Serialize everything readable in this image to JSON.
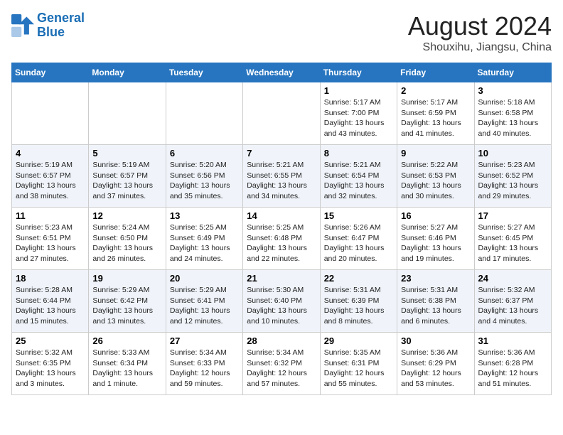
{
  "header": {
    "logo_line1": "General",
    "logo_line2": "Blue",
    "title": "August 2024",
    "subtitle": "Shouxihu, Jiangsu, China"
  },
  "days_of_week": [
    "Sunday",
    "Monday",
    "Tuesday",
    "Wednesday",
    "Thursday",
    "Friday",
    "Saturday"
  ],
  "weeks": [
    [
      {
        "day": "",
        "content": ""
      },
      {
        "day": "",
        "content": ""
      },
      {
        "day": "",
        "content": ""
      },
      {
        "day": "",
        "content": ""
      },
      {
        "day": "1",
        "content": "Sunrise: 5:17 AM\nSunset: 7:00 PM\nDaylight: 13 hours\nand 43 minutes."
      },
      {
        "day": "2",
        "content": "Sunrise: 5:17 AM\nSunset: 6:59 PM\nDaylight: 13 hours\nand 41 minutes."
      },
      {
        "day": "3",
        "content": "Sunrise: 5:18 AM\nSunset: 6:58 PM\nDaylight: 13 hours\nand 40 minutes."
      }
    ],
    [
      {
        "day": "4",
        "content": "Sunrise: 5:19 AM\nSunset: 6:57 PM\nDaylight: 13 hours\nand 38 minutes."
      },
      {
        "day": "5",
        "content": "Sunrise: 5:19 AM\nSunset: 6:57 PM\nDaylight: 13 hours\nand 37 minutes."
      },
      {
        "day": "6",
        "content": "Sunrise: 5:20 AM\nSunset: 6:56 PM\nDaylight: 13 hours\nand 35 minutes."
      },
      {
        "day": "7",
        "content": "Sunrise: 5:21 AM\nSunset: 6:55 PM\nDaylight: 13 hours\nand 34 minutes."
      },
      {
        "day": "8",
        "content": "Sunrise: 5:21 AM\nSunset: 6:54 PM\nDaylight: 13 hours\nand 32 minutes."
      },
      {
        "day": "9",
        "content": "Sunrise: 5:22 AM\nSunset: 6:53 PM\nDaylight: 13 hours\nand 30 minutes."
      },
      {
        "day": "10",
        "content": "Sunrise: 5:23 AM\nSunset: 6:52 PM\nDaylight: 13 hours\nand 29 minutes."
      }
    ],
    [
      {
        "day": "11",
        "content": "Sunrise: 5:23 AM\nSunset: 6:51 PM\nDaylight: 13 hours\nand 27 minutes."
      },
      {
        "day": "12",
        "content": "Sunrise: 5:24 AM\nSunset: 6:50 PM\nDaylight: 13 hours\nand 26 minutes."
      },
      {
        "day": "13",
        "content": "Sunrise: 5:25 AM\nSunset: 6:49 PM\nDaylight: 13 hours\nand 24 minutes."
      },
      {
        "day": "14",
        "content": "Sunrise: 5:25 AM\nSunset: 6:48 PM\nDaylight: 13 hours\nand 22 minutes."
      },
      {
        "day": "15",
        "content": "Sunrise: 5:26 AM\nSunset: 6:47 PM\nDaylight: 13 hours\nand 20 minutes."
      },
      {
        "day": "16",
        "content": "Sunrise: 5:27 AM\nSunset: 6:46 PM\nDaylight: 13 hours\nand 19 minutes."
      },
      {
        "day": "17",
        "content": "Sunrise: 5:27 AM\nSunset: 6:45 PM\nDaylight: 13 hours\nand 17 minutes."
      }
    ],
    [
      {
        "day": "18",
        "content": "Sunrise: 5:28 AM\nSunset: 6:44 PM\nDaylight: 13 hours\nand 15 minutes."
      },
      {
        "day": "19",
        "content": "Sunrise: 5:29 AM\nSunset: 6:42 PM\nDaylight: 13 hours\nand 13 minutes."
      },
      {
        "day": "20",
        "content": "Sunrise: 5:29 AM\nSunset: 6:41 PM\nDaylight: 13 hours\nand 12 minutes."
      },
      {
        "day": "21",
        "content": "Sunrise: 5:30 AM\nSunset: 6:40 PM\nDaylight: 13 hours\nand 10 minutes."
      },
      {
        "day": "22",
        "content": "Sunrise: 5:31 AM\nSunset: 6:39 PM\nDaylight: 13 hours\nand 8 minutes."
      },
      {
        "day": "23",
        "content": "Sunrise: 5:31 AM\nSunset: 6:38 PM\nDaylight: 13 hours\nand 6 minutes."
      },
      {
        "day": "24",
        "content": "Sunrise: 5:32 AM\nSunset: 6:37 PM\nDaylight: 13 hours\nand 4 minutes."
      }
    ],
    [
      {
        "day": "25",
        "content": "Sunrise: 5:32 AM\nSunset: 6:35 PM\nDaylight: 13 hours\nand 3 minutes."
      },
      {
        "day": "26",
        "content": "Sunrise: 5:33 AM\nSunset: 6:34 PM\nDaylight: 13 hours\nand 1 minute."
      },
      {
        "day": "27",
        "content": "Sunrise: 5:34 AM\nSunset: 6:33 PM\nDaylight: 12 hours\nand 59 minutes."
      },
      {
        "day": "28",
        "content": "Sunrise: 5:34 AM\nSunset: 6:32 PM\nDaylight: 12 hours\nand 57 minutes."
      },
      {
        "day": "29",
        "content": "Sunrise: 5:35 AM\nSunset: 6:31 PM\nDaylight: 12 hours\nand 55 minutes."
      },
      {
        "day": "30",
        "content": "Sunrise: 5:36 AM\nSunset: 6:29 PM\nDaylight: 12 hours\nand 53 minutes."
      },
      {
        "day": "31",
        "content": "Sunrise: 5:36 AM\nSunset: 6:28 PM\nDaylight: 12 hours\nand 51 minutes."
      }
    ]
  ]
}
